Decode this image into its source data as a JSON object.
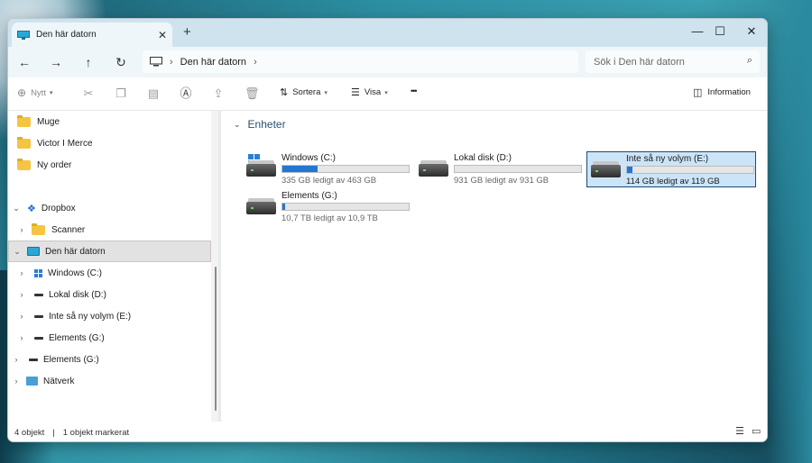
{
  "window": {
    "tab_title": "Den här datorn",
    "new_tab": "+",
    "controls": {
      "minimize": "—",
      "maximize": "☐",
      "close": "✕"
    }
  },
  "nav": {
    "back": "←",
    "forward": "→",
    "up": "↑",
    "refresh": "↻",
    "breadcrumb": [
      "Den här datorn"
    ],
    "search_placeholder": "Sök i Den här datorn"
  },
  "toolbar": {
    "new_label": "Nytt",
    "sort_label": "Sortera",
    "view_label": "Visa",
    "more": "•••",
    "details_label": "Information"
  },
  "sidebar": {
    "items": [
      {
        "label": "Muge",
        "icon": "folder-icon"
      },
      {
        "label": "Victor I Merce",
        "icon": "folder-icon"
      },
      {
        "label": "Ny order",
        "icon": "folder-icon"
      },
      {
        "label": "Dropbox",
        "icon": "dropbox-icon"
      },
      {
        "label": "Scanner",
        "icon": "folder-icon"
      },
      {
        "label": "Den här datorn",
        "icon": "computer-icon"
      },
      {
        "label": "Windows (C:)",
        "icon": "windows-drive-icon"
      },
      {
        "label": "Lokal disk (D:)",
        "icon": "drive-icon"
      },
      {
        "label": "Inte så ny volym (E:)",
        "icon": "drive-icon"
      },
      {
        "label": "Elements (G:)",
        "icon": "drive-icon"
      },
      {
        "label": "Elements (G:)",
        "icon": "drive-icon"
      },
      {
        "label": "Nätverk",
        "icon": "network-icon"
      }
    ]
  },
  "content": {
    "group_title": "Enheter",
    "drives": [
      {
        "name": "Windows (C:)",
        "free_text": "335 GB ledigt av 463 GB",
        "used_fraction": 0.276
      },
      {
        "name": "Lokal disk (D:)",
        "free_text": "931 GB ledigt av 931 GB",
        "used_fraction": 0.0
      },
      {
        "name": "Inte så ny volym (E:)",
        "free_text": "114 GB ledigt av 119 GB",
        "used_fraction": 0.042
      },
      {
        "name": "Elements (G:)",
        "free_text": "10,7 TB ledigt av 10,9 TB",
        "used_fraction": 0.018
      }
    ]
  },
  "status": {
    "count": "4 objekt",
    "selected": "1 objekt markerat"
  },
  "colors": {
    "accent": "#2178d4",
    "selection": "#cce4f7",
    "titlebar": "#cfe3ee"
  }
}
